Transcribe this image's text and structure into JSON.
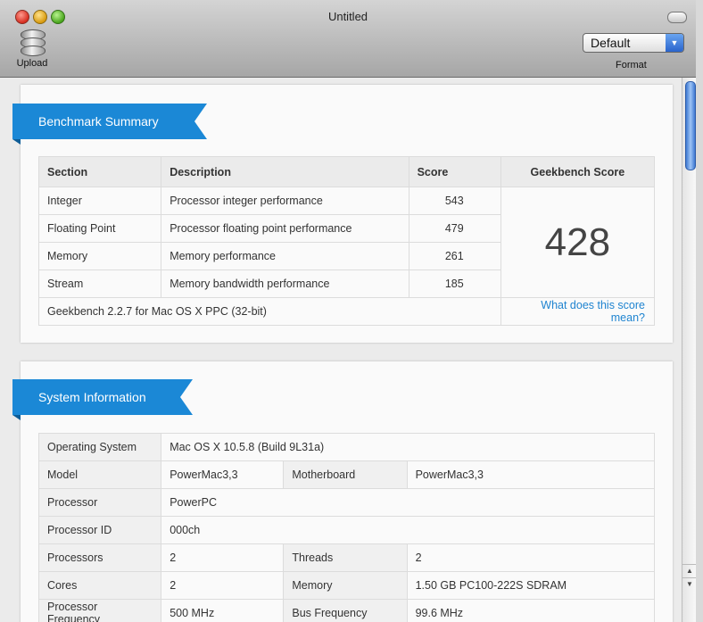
{
  "window": {
    "title": "Untitled"
  },
  "toolbar": {
    "upload_label": "Upload",
    "format_value": "Default",
    "format_label": "Format"
  },
  "benchmark": {
    "heading": "Benchmark Summary",
    "columns": [
      "Section",
      "Description",
      "Score",
      "Geekbench Score"
    ],
    "rows": [
      {
        "section": "Integer",
        "description": "Processor integer performance",
        "score": "543"
      },
      {
        "section": "Floating Point",
        "description": "Processor floating point performance",
        "score": "479"
      },
      {
        "section": "Memory",
        "description": "Memory performance",
        "score": "261"
      },
      {
        "section": "Stream",
        "description": "Memory bandwidth performance",
        "score": "185"
      }
    ],
    "geekbench_score": "428",
    "footer_version": "Geekbench 2.2.7 for Mac OS X PPC (32-bit)",
    "footer_link": "What does this score mean?"
  },
  "system": {
    "heading": "System Information",
    "os_label": "Operating System",
    "os_value": "Mac OS X 10.5.8 (Build 9L31a)",
    "model_label": "Model",
    "model_value": "PowerMac3,3",
    "motherboard_label": "Motherboard",
    "motherboard_value": "PowerMac3,3",
    "processor_label": "Processor",
    "processor_value": "PowerPC",
    "processor_id_label": "Processor ID",
    "processor_id_value": "000ch",
    "processors_label": "Processors",
    "processors_value": "2",
    "threads_label": "Threads",
    "threads_value": "2",
    "cores_label": "Cores",
    "cores_value": "2",
    "memory_label": "Memory",
    "memory_value": "1.50 GB PC100-222S SDRAM",
    "freq_label": "Processor Frequency",
    "freq_value": "500 MHz",
    "bus_label": "Bus Frequency",
    "bus_value": "99.6 MHz"
  }
}
